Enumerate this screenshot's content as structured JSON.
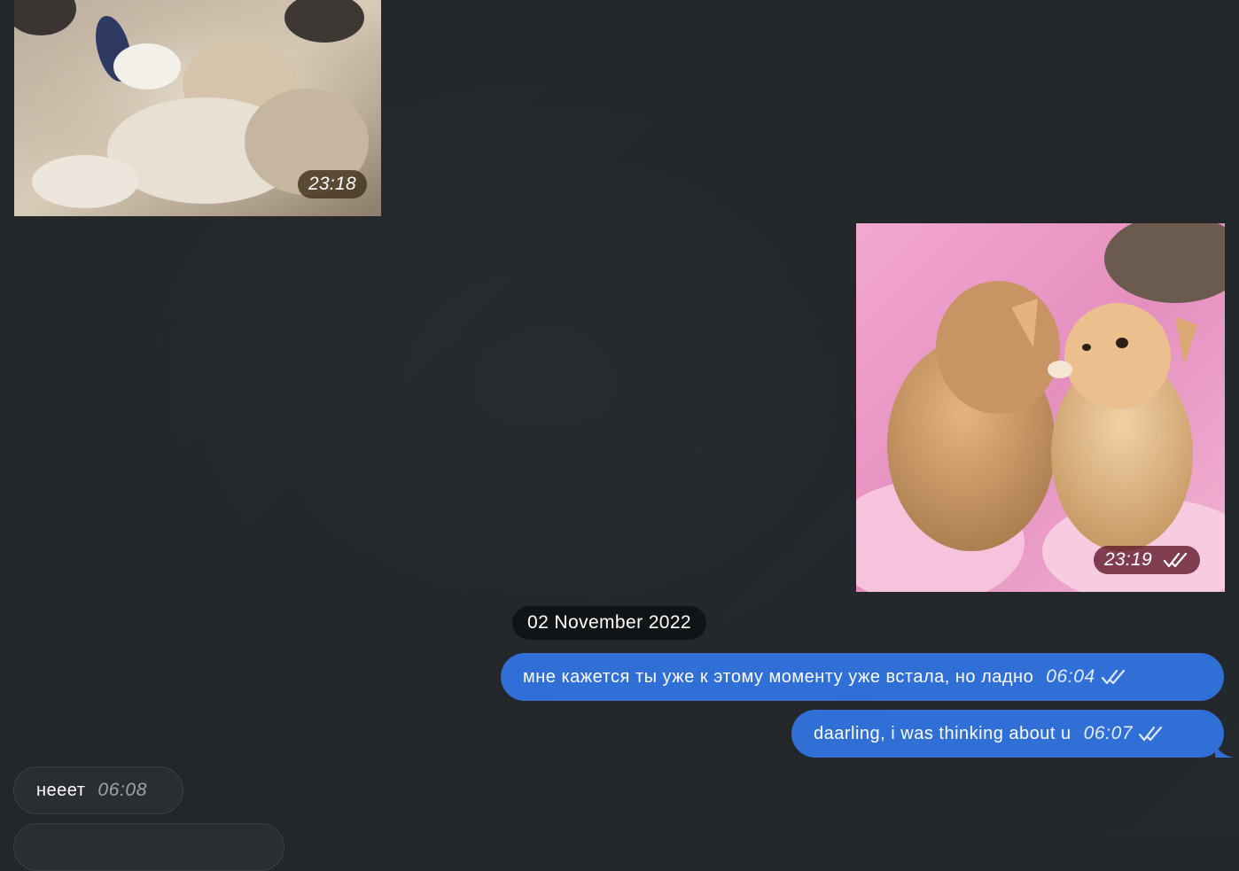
{
  "conversation": {
    "messages": [
      {
        "type": "media",
        "direction": "incoming",
        "time": "23:18",
        "image": "kitten-photo"
      },
      {
        "type": "media",
        "direction": "outgoing",
        "time": "23:19",
        "read_receipt": "double-check-icon",
        "image": "two-kittens-kissing-photo"
      },
      {
        "type": "date_separator",
        "label": "02 November 2022"
      },
      {
        "type": "text",
        "direction": "outgoing",
        "text": "мне кажется ты уже к этому моменту уже встала, но ладно",
        "time": "06:04",
        "read_receipt": "double-check-icon"
      },
      {
        "type": "text",
        "direction": "outgoing",
        "text": "daarling, i was thinking about u",
        "time": "06:07",
        "read_receipt": "double-check-icon"
      },
      {
        "type": "text",
        "direction": "incoming",
        "text": "нееет",
        "time": "06:08"
      }
    ]
  },
  "colors": {
    "background": "#23272a",
    "outgoing_bubble": "#2f6fd6",
    "incoming_bubble": "#2a2e32",
    "date_pill": "#111417"
  }
}
